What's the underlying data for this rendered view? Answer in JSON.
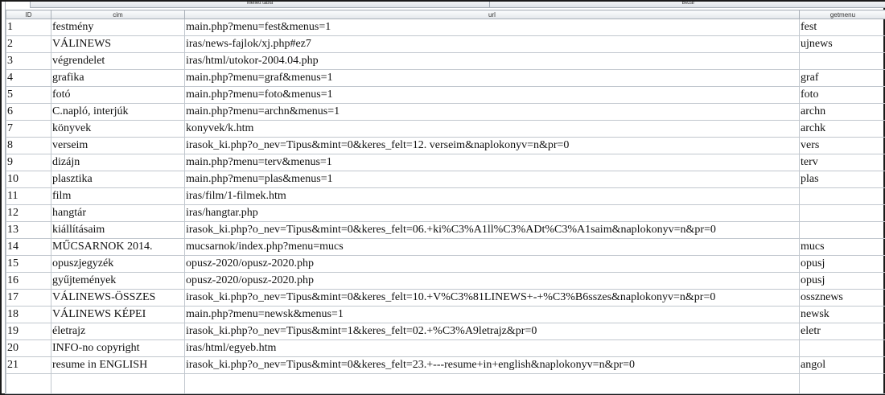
{
  "tabs": [
    {
      "label": "Mellett tábla"
    },
    {
      "label": "Bezár"
    }
  ],
  "columns": [
    {
      "key": "id",
      "label": "ID"
    },
    {
      "key": "cim",
      "label": "cim"
    },
    {
      "key": "url",
      "label": "url"
    },
    {
      "key": "getmenu",
      "label": "getmenu"
    }
  ],
  "rows": [
    {
      "id": "1",
      "cim": "festmény",
      "url": "main.php?menu=fest&menus=1",
      "getmenu": "fest"
    },
    {
      "id": "2",
      "cim": "VÁLINEWS",
      "url": "iras/news-fajlok/xj.php#ez7",
      "getmenu": "ujnews"
    },
    {
      "id": "3",
      "cim": "végrendelet",
      "url": "iras/html/utokor-2004.04.php",
      "getmenu": ""
    },
    {
      "id": "4",
      "cim": "grafika",
      "url": "main.php?menu=graf&menus=1",
      "getmenu": "graf"
    },
    {
      "id": "5",
      "cim": "fotó",
      "url": "main.php?menu=foto&menus=1",
      "getmenu": "foto"
    },
    {
      "id": "6",
      "cim": "C.napló, interjúk",
      "url": "main.php?menu=archn&menus=1",
      "getmenu": "archn"
    },
    {
      "id": "7",
      "cim": "könyvek",
      "url": "konyvek/k.htm",
      "getmenu": "archk"
    },
    {
      "id": "8",
      "cim": "verseim",
      "url": "irasok_ki.php?o_nev=Tipus&mint=0&keres_felt=12. verseim&naplokonyv=n&pr=0",
      "getmenu": "vers"
    },
    {
      "id": "9",
      "cim": "dizájn",
      "url": "main.php?menu=terv&menus=1",
      "getmenu": "terv"
    },
    {
      "id": "10",
      "cim": "plasztika",
      "url": "main.php?menu=plas&menus=1",
      "getmenu": "plas"
    },
    {
      "id": "11",
      "cim": "film",
      "url": "iras/film/1-filmek.htm",
      "getmenu": ""
    },
    {
      "id": "12",
      "cim": "hangtár",
      "url": "iras/hangtar.php",
      "getmenu": ""
    },
    {
      "id": "13",
      "cim": "kiállításaim",
      "url": "irasok_ki.php?o_nev=Tipus&mint=0&keres_felt=06.+ki%C3%A1ll%C3%ADt%C3%A1saim&naplokonyv=n&pr=0",
      "getmenu": ""
    },
    {
      "id": "14",
      "cim": "MŰCSARNOK 2014.",
      "url": "mucsarnok/index.php?menu=mucs",
      "getmenu": "mucs"
    },
    {
      "id": "15",
      "cim": "opuszjegyzék",
      "url": "opusz-2020/opusz-2020.php",
      "getmenu": "opusj"
    },
    {
      "id": "16",
      "cim": "gyűjtemények",
      "url": "opusz-2020/opusz-2020.php",
      "getmenu": "opusj"
    },
    {
      "id": "17",
      "cim": "VÁLINEWS-ÖSSZES",
      "url": "irasok_ki.php?o_nev=Tipus&mint=0&keres_felt=10.+V%C3%81LINEWS+-+%C3%B6sszes&naplokonyv=n&pr=0",
      "getmenu": "ossznews"
    },
    {
      "id": "18",
      "cim": "VÁLINEWS KÉPEI",
      "url": "main.php?menu=newsk&menus=1",
      "getmenu": "newsk"
    },
    {
      "id": "19",
      "cim": "életrajz",
      "url": "irasok_ki.php?o_nev=Tipus&mint=1&keres_felt=02.+%C3%A9letrajz&pr=0",
      "getmenu": "eletr"
    },
    {
      "id": "20",
      "cim": "INFO-no copyright",
      "url": "iras/html/egyeb.htm",
      "getmenu": ""
    },
    {
      "id": "21",
      "cim": "resume in ENGLISH",
      "url": "irasok_ki.php?o_nev=Tipus&mint=0&keres_felt=23.+---resume+in+english&naplokonyv=n&pr=0",
      "getmenu": "angol"
    }
  ]
}
